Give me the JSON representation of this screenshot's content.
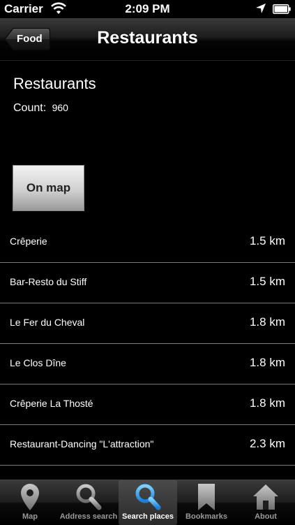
{
  "status_bar": {
    "carrier": "Carrier",
    "time": "2:09 PM"
  },
  "nav": {
    "back_label": "Food",
    "title": "Restaurants"
  },
  "header": {
    "title": "Restaurants",
    "count_label": "Count:",
    "count_value": "960"
  },
  "on_map_label": "On map",
  "restaurants": [
    {
      "name": "Crêperie",
      "distance": "1.5 km"
    },
    {
      "name": "Bar-Resto du Stiff",
      "distance": "1.5 km"
    },
    {
      "name": "Le Fer du Cheval",
      "distance": "1.8 km"
    },
    {
      "name": "Le Clos Dîne",
      "distance": "1.8 km"
    },
    {
      "name": "Crêperie La Thosté",
      "distance": "1.8 km"
    },
    {
      "name": "Restaurant-Dancing \"L'attraction\"",
      "distance": "2.3 km"
    }
  ],
  "tabs": [
    {
      "label": "Map",
      "icon": "map-pin-icon"
    },
    {
      "label": "Address search",
      "icon": "magnifier-icon"
    },
    {
      "label": "Search places",
      "icon": "magnifier-icon",
      "selected": true
    },
    {
      "label": "Bookmarks",
      "icon": "bookmark-icon"
    },
    {
      "label": "About",
      "icon": "house-icon"
    }
  ]
}
